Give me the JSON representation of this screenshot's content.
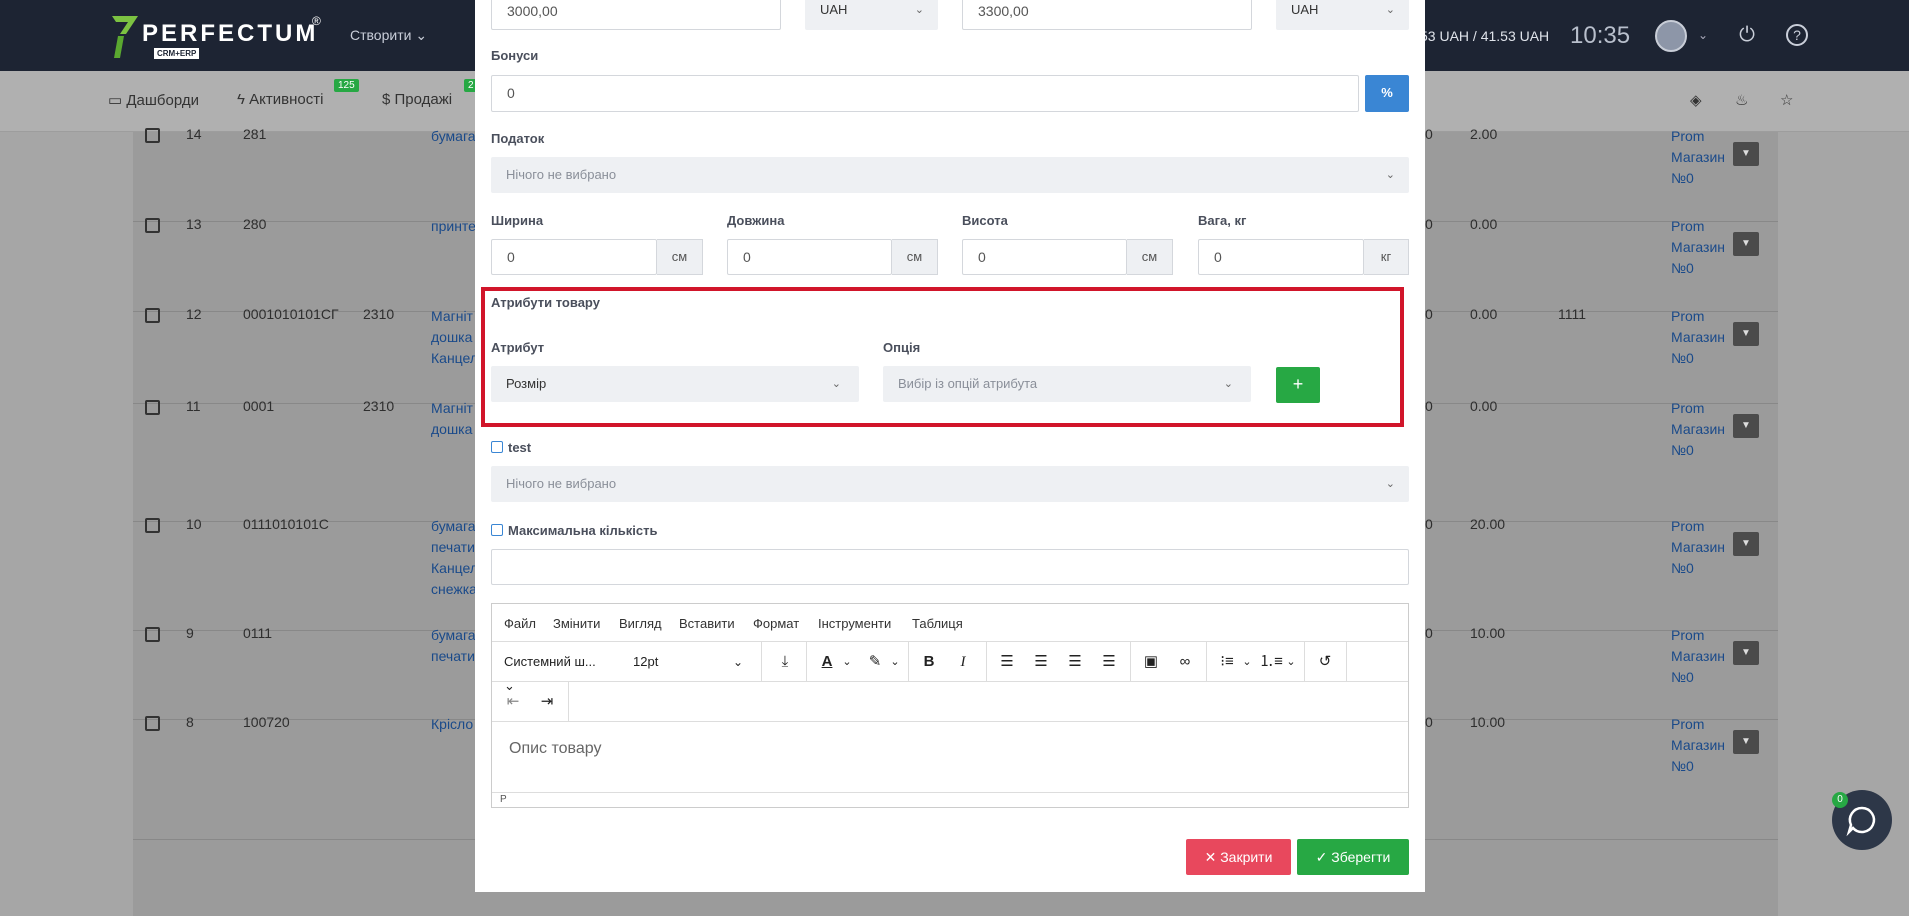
{
  "topbar": {
    "logo_text": "PERFECTUM",
    "logo_reg": "®",
    "logo_tag": "CRM+ERP",
    "create_label": "Створити",
    "rate_text": "53 UAH / 41.53 UAH",
    "clock": "10:35"
  },
  "subnav": {
    "dashboards": "Дашборди",
    "activities": "Активності",
    "activities_badge": "125",
    "sales": "Продажі",
    "sales_badge": "2"
  },
  "bg_table": {
    "rows": [
      {
        "n": "14",
        "code": "281",
        "ext": "",
        "name": "бумага",
        "qty": "0",
        "price": "2.00",
        "extra": "",
        "store": [
          "Prom",
          "Магазин",
          "№0"
        ]
      },
      {
        "n": "13",
        "code": "280",
        "ext": "",
        "name": "принте",
        "qty": "0",
        "price": "0.00",
        "extra": "",
        "store": [
          "Prom",
          "Магазин",
          "№0"
        ]
      },
      {
        "n": "12",
        "code": "0001010101СГ",
        "ext": "2310",
        "name": "Магніт дошка Канцел",
        "qty": "0",
        "price": "0.00",
        "extra": "1111",
        "store": [
          "Prom",
          "Магазин",
          "№0"
        ]
      },
      {
        "n": "11",
        "code": "0001",
        "ext": "2310",
        "name": "Магніт дошка",
        "qty": "0",
        "price": "0.00",
        "extra": "",
        "store": [
          "Prom",
          "Магазин",
          "№0"
        ]
      },
      {
        "n": "10",
        "code": "0111010101С",
        "ext": "",
        "name": "бумага печати Канцел снежка",
        "qty": "0",
        "price": "20.00",
        "extra": "",
        "store": [
          "Prom",
          "Магазин",
          "№0"
        ]
      },
      {
        "n": "9",
        "code": "0111",
        "ext": "",
        "name": "бумага печати",
        "qty": "0",
        "price": "10.00",
        "extra": "",
        "store": [
          "Prom",
          "Магазин",
          "№0"
        ]
      },
      {
        "n": "8",
        "code": "100720",
        "ext": "",
        "name": "Крісло",
        "qty": "0",
        "price": "10.00",
        "extra": "",
        "store": [
          "Prom",
          "Магазин",
          "№0"
        ]
      }
    ]
  },
  "modal": {
    "price1_value": "3000,00",
    "currency1": "UAH",
    "price2_value": "3300,00",
    "currency2": "UAH",
    "bonuses_label": "Бонуси",
    "bonuses_value": "0",
    "bonuses_suffix": "%",
    "tax_label": "Податок",
    "tax_placeholder": "Нічого не вибрано",
    "width_label": "Ширина",
    "width_value": "0",
    "width_unit": "см",
    "length_label": "Довжина",
    "length_value": "0",
    "length_unit": "см",
    "height_label": "Висота",
    "height_value": "0",
    "height_unit": "см",
    "weight_label": "Вага, кг",
    "weight_value": "0",
    "weight_unit": "кг",
    "attributes_title": "Атрибути товару",
    "attribute_label": "Атрибут",
    "attribute_value": "Розмір",
    "option_label": "Опція",
    "option_placeholder": "Вибір із опцій атрибута",
    "add_label": "+",
    "test_label": "test",
    "test_placeholder": "Нічого не вибрано",
    "max_qty_label": "Максимальна кількість",
    "max_qty_value": "",
    "editor": {
      "menu": [
        "Файл",
        "Змінити",
        "Вигляд",
        "Вставити",
        "Формат",
        "Інструменти",
        "Таблиця"
      ],
      "font_family": "Системний ш...",
      "font_size": "12pt",
      "body_placeholder": "Опис товару",
      "status_path": "P"
    },
    "close_label": "Закрити",
    "save_label": "Зберегти"
  },
  "chat": {
    "badge": "0"
  },
  "colors": {
    "topbar": "#1d2433",
    "accent_blue": "#3a86d4",
    "success_green": "#27a844",
    "danger_red": "#e8485d",
    "highlight_red": "#d1152a"
  }
}
